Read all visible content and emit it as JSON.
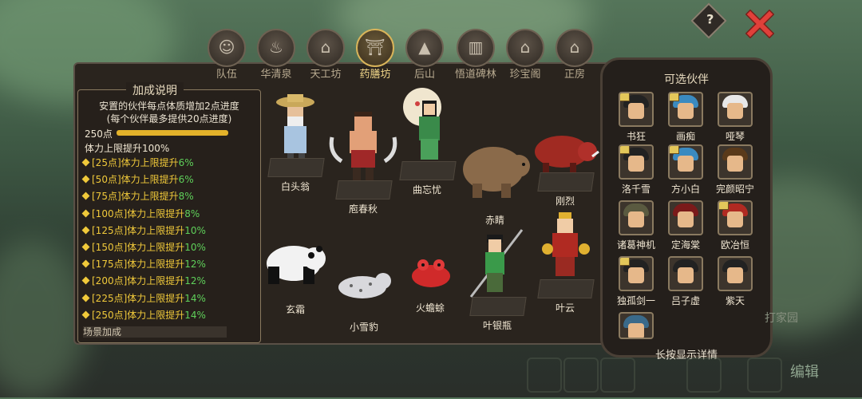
{
  "tabs": [
    {
      "label": "队伍",
      "icon": "team-icon",
      "glyph": "☺"
    },
    {
      "label": "华清泉",
      "icon": "spring-icon",
      "glyph": "♨"
    },
    {
      "label": "天工坊",
      "icon": "workshop-icon",
      "glyph": "⌂"
    },
    {
      "label": "药膳坊",
      "icon": "kitchen-icon",
      "glyph": "⛩"
    },
    {
      "label": "后山",
      "icon": "mountain-icon",
      "glyph": "▲"
    },
    {
      "label": "悟道碑林",
      "icon": "stele-icon",
      "glyph": "▥"
    },
    {
      "label": "珍宝阁",
      "icon": "pavilion-icon",
      "glyph": "⌂"
    },
    {
      "label": "正房",
      "icon": "house-icon",
      "glyph": "⌂"
    }
  ],
  "active_tab": 3,
  "help_label": "?",
  "info": {
    "title": "加成说明",
    "desc_line1": "安置的伙伴每点体质增加2点进度",
    "desc_line2": "(每个伙伴最多提供20点进度)",
    "points": "250点",
    "progress_fraction": 1.0,
    "base": "体力上限提升100%",
    "bonuses": [
      {
        "k": "[25点]体力上限提升",
        "v": "6%"
      },
      {
        "k": "[50点]体力上限提升",
        "v": "6%"
      },
      {
        "k": "[75点]体力上限提升",
        "v": "8%"
      },
      {
        "k": "[100点]体力上限提升",
        "v": "8%"
      },
      {
        "k": "[125点]体力上限提升",
        "v": "10%"
      },
      {
        "k": "[150点]体力上限提升",
        "v": "10%"
      },
      {
        "k": "[175点]体力上限提升",
        "v": "12%"
      },
      {
        "k": "[200点]体力上限提升",
        "v": "12%"
      },
      {
        "k": "[225点]体力上限提升",
        "v": "14%"
      },
      {
        "k": "[250点]体力上限提升",
        "v": "14%"
      }
    ],
    "scene_label": "场景加成"
  },
  "pets": {
    "p1": "白头翁",
    "p2": "庖春秋",
    "p3": "曲忘忧",
    "p4": "赤睛",
    "p5": "刚烈",
    "p6": "玄霜",
    "p7": "小雪豹",
    "p8": "火蟾蜍",
    "p9": "叶银瓶",
    "p10": "叶云"
  },
  "pool": {
    "title": "可选伙伴",
    "tip": "长按显示详情",
    "slots": [
      "书狂",
      "画痴",
      "哑琴",
      "洛千雪",
      "方小白",
      "完颜昭宁",
      "诸葛神机",
      "定海棠",
      "欧冶恒",
      "独孤剑一",
      "吕子虚",
      "紫天",
      ""
    ]
  },
  "garden_label": "打家园",
  "edit_label": "编辑",
  "colors": {
    "accent": "#f0c93a",
    "green": "#5fd05a",
    "close_red": "#e0403a"
  }
}
